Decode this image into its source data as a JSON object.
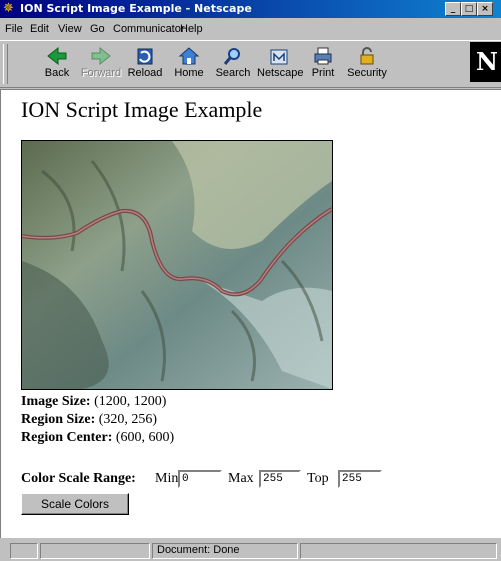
{
  "window": {
    "title": "ION Script Image Example - Netscape"
  },
  "menu": [
    {
      "label": "File"
    },
    {
      "label": "Edit"
    },
    {
      "label": "View"
    },
    {
      "label": "Go"
    },
    {
      "label": "Communicator"
    },
    {
      "label": "Help"
    }
  ],
  "toolbar": {
    "buttons": [
      {
        "label": "Back",
        "icon": "back-arrow-icon"
      },
      {
        "label": "Forward",
        "icon": "forward-arrow-icon",
        "disabled": true
      },
      {
        "label": "Reload",
        "icon": "reload-icon"
      },
      {
        "label": "Home",
        "icon": "home-icon"
      },
      {
        "label": "Search",
        "icon": "search-icon"
      },
      {
        "label": "Netscape",
        "icon": "netscape-icon"
      },
      {
        "label": "Print",
        "icon": "print-icon"
      },
      {
        "label": "Security",
        "icon": "lock-icon"
      }
    ],
    "logo": "N"
  },
  "page": {
    "heading": "ION Script Image Example",
    "image_size_label": "Image Size:",
    "image_size_value": "(1200, 1200)",
    "region_size_label": "Region Size:",
    "region_size_value": "(320, 256)",
    "region_center_label": "Region Center:",
    "region_center_value": "(600, 600)",
    "scale_label": "Color Scale Range:",
    "min_label": "Min",
    "min_value": "0",
    "max_label": "Max",
    "max_value": "255",
    "top_label": "Top",
    "top_value": "255",
    "scale_button": "Scale Colors"
  },
  "status": {
    "text": "Document: Done"
  },
  "colors": {
    "titlebar": "#000080",
    "chrome": "#c0c0c0"
  }
}
